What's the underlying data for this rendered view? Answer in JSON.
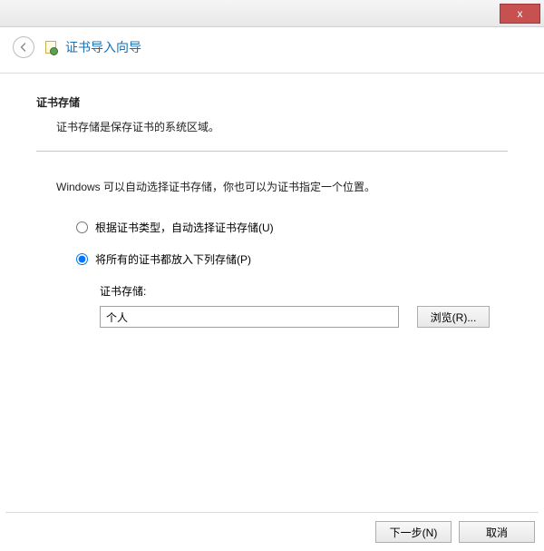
{
  "titlebar": {
    "close": "x"
  },
  "header": {
    "title": "证书导入向导"
  },
  "section": {
    "title": "证书存储",
    "desc": "证书存储是保存证书的系统区域。"
  },
  "info": "Windows 可以自动选择证书存储，你也可以为证书指定一个位置。",
  "radios": {
    "auto": "根据证书类型，自动选择证书存储(U)",
    "place": "将所有的证书都放入下列存储(P)"
  },
  "store": {
    "label": "证书存储:",
    "value": "个人",
    "browse": "浏览(R)..."
  },
  "footer": {
    "next": "下一步(N)",
    "cancel": "取消"
  }
}
